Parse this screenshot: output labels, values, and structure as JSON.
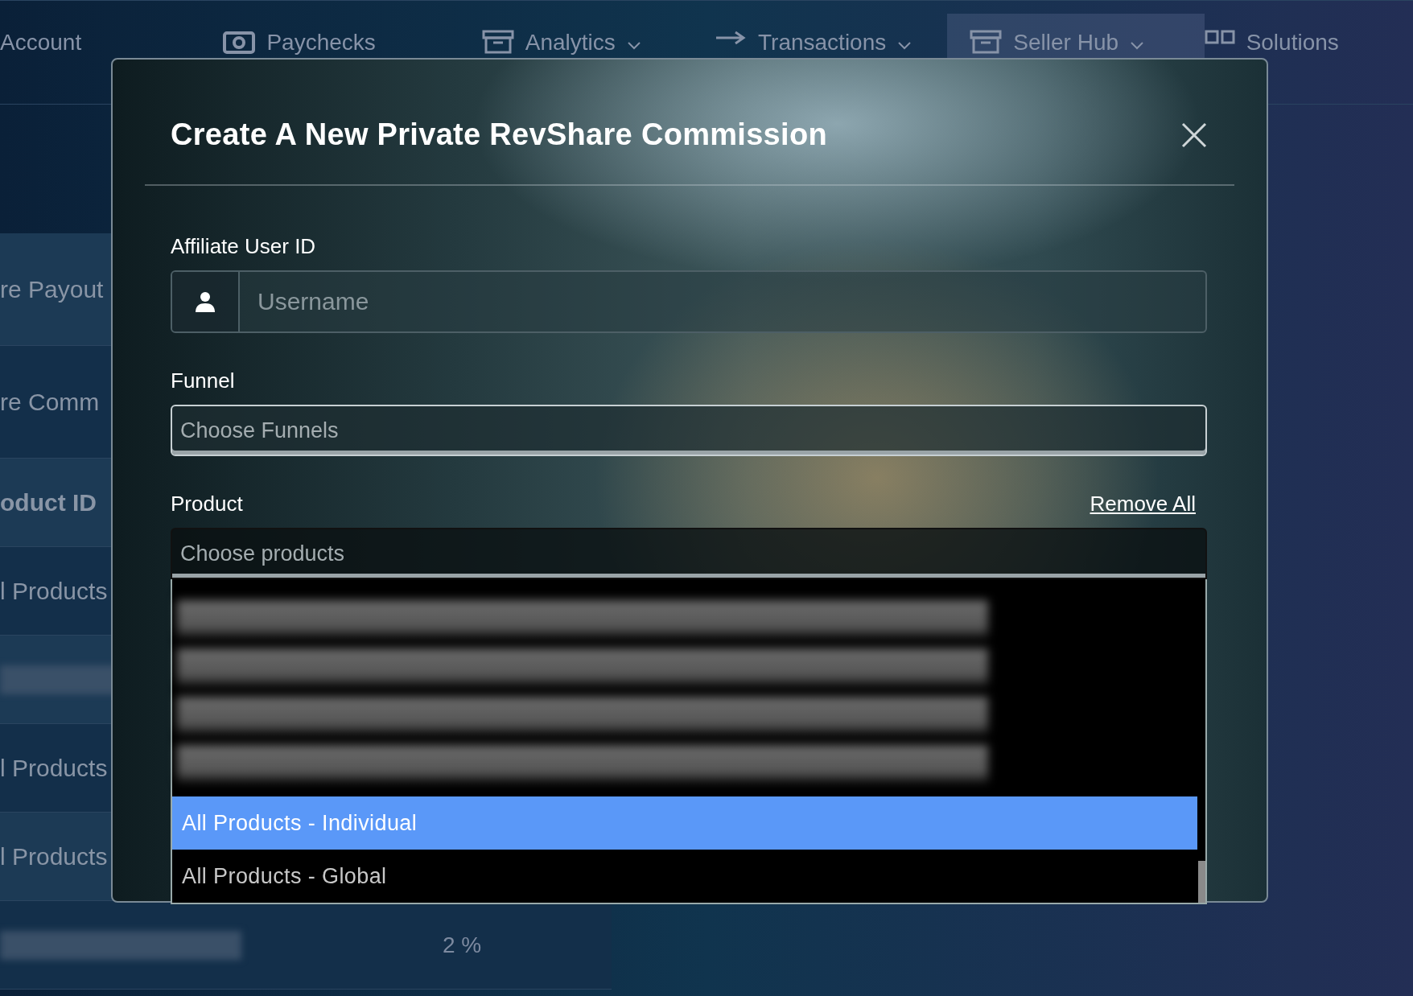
{
  "nav": {
    "items": [
      {
        "label": "Account",
        "selected": false,
        "chevron": false
      },
      {
        "label": "Paychecks",
        "selected": false,
        "chevron": false
      },
      {
        "label": "Analytics",
        "selected": false,
        "chevron": true
      },
      {
        "label": "Transactions",
        "selected": false,
        "chevron": true
      },
      {
        "label": "Seller Hub",
        "selected": true,
        "chevron": true
      },
      {
        "label": "Solutions",
        "selected": false,
        "chevron": false
      }
    ]
  },
  "background_table": {
    "rows": [
      {
        "kind": "heading",
        "text": "re Payout"
      },
      {
        "kind": "heading",
        "text": "re Comm"
      },
      {
        "kind": "column",
        "text": "oduct ID"
      },
      {
        "kind": "text",
        "text": "l Products"
      },
      {
        "kind": "redacted"
      },
      {
        "kind": "text",
        "text": "l Products"
      },
      {
        "kind": "text",
        "text": "l Products"
      },
      {
        "kind": "redacted",
        "cell_2": "2 %"
      }
    ]
  },
  "modal": {
    "title": "Create A New Private RevShare Commission",
    "fields": [
      {
        "kind": "user",
        "label": "Affiliate User ID",
        "placeholder": "Username"
      },
      {
        "kind": "select",
        "label": "Funnel",
        "placeholder": "Choose Funnels"
      },
      {
        "kind": "multiselect",
        "label": "Product",
        "action": "Remove All",
        "placeholder": "Choose products",
        "open": true,
        "options": [
          {
            "label": "All Products - Individual",
            "selected": true
          },
          {
            "label": "All Products - Global",
            "selected": false
          }
        ]
      }
    ]
  }
}
